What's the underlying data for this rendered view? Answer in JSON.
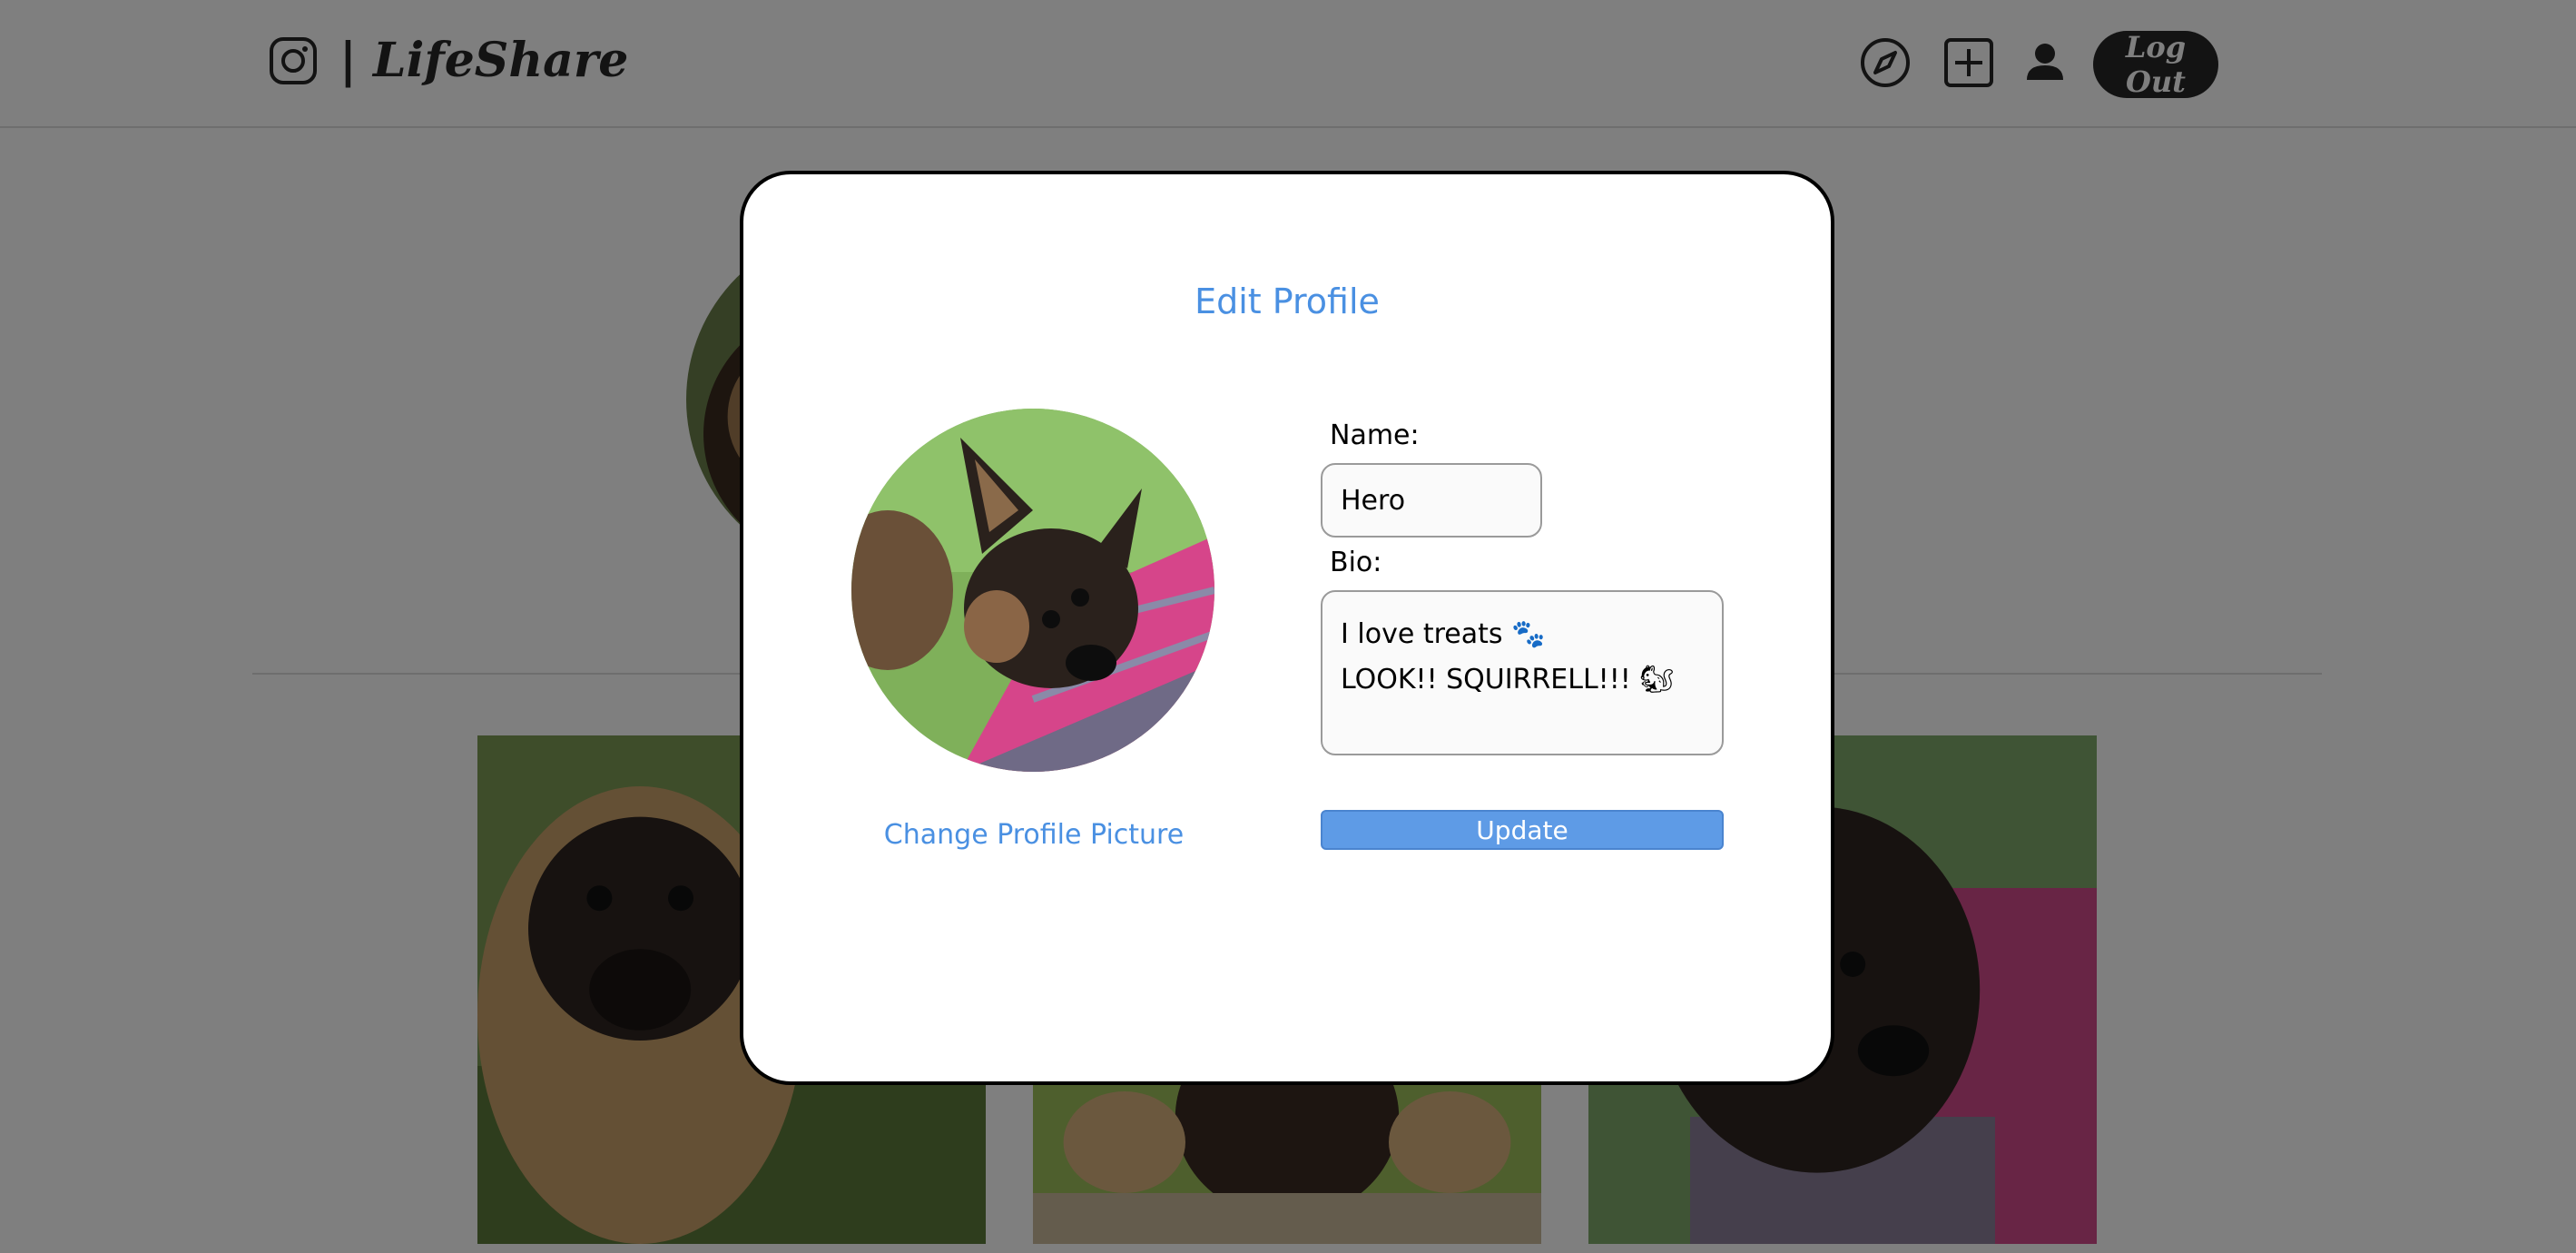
{
  "header": {
    "brand": "| LifeShare",
    "logout_label": "Log Out",
    "icons": [
      "instagram-logo-icon",
      "compass-icon",
      "add-post-icon",
      "profile-icon"
    ]
  },
  "modal": {
    "title": "Edit Profile",
    "change_picture_label": "Change Profile Picture",
    "name_label": "Name:",
    "name_value": "Hero",
    "bio_label": "Bio:",
    "bio_value": "I love treats 🐾\nLOOK!! SQUIRRELL!!! 🐿",
    "update_label": "Update"
  },
  "colors": {
    "accent": "#4a90e2",
    "button": "#5e9be6",
    "dark": "#262626",
    "overlay": "rgba(0,0,0,0.5)"
  }
}
